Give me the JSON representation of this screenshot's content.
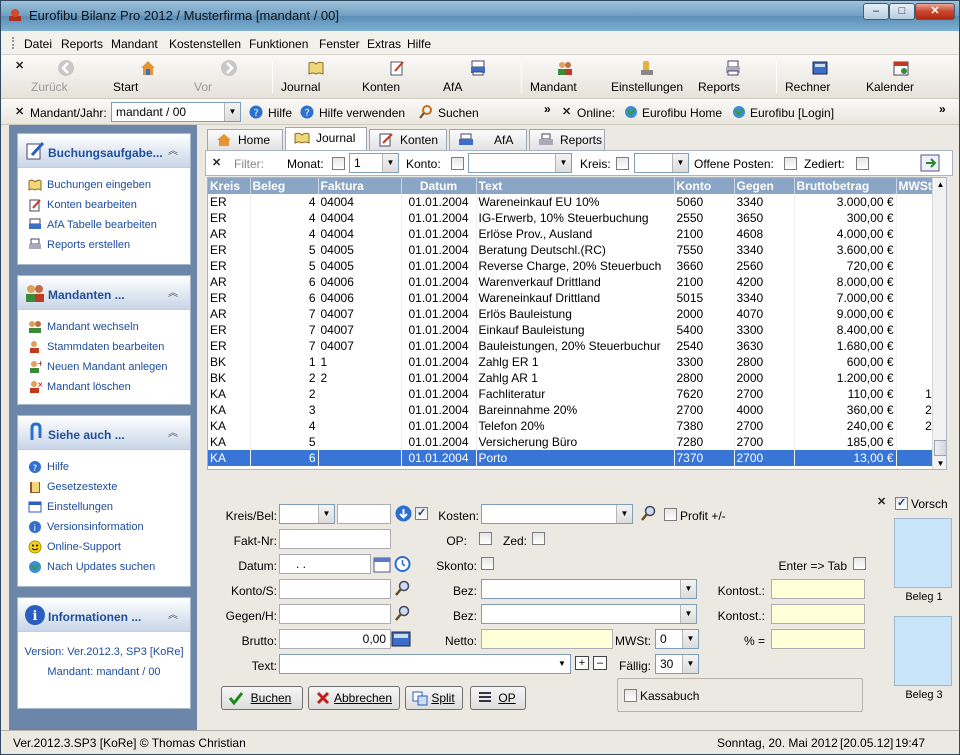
{
  "window": {
    "title": "Eurofibu Bilanz Pro 2012 / Musterfirma [mandant / 00]"
  },
  "menu": [
    "Datei",
    "Reports",
    "Mandant",
    "Kostenstellen",
    "Funktionen",
    "Fenster",
    "Extras",
    "Hilfe"
  ],
  "toolbar": {
    "zurueck": "Zurück",
    "start": "Start",
    "vor": "Vor",
    "journal": "Journal",
    "konten": "Konten",
    "afa": "AfA",
    "mandant": "Mandant",
    "einstellungen": "Einstellungen",
    "reports": "Reports",
    "rechner": "Rechner",
    "kalender": "Kalender"
  },
  "bar2": {
    "mandant_label": "Mandant/Jahr:",
    "mandant_value": "mandant / 00",
    "hilfe": "Hilfe",
    "hilfe_verwenden": "Hilfe verwenden",
    "suchen": "Suchen",
    "online": "Online:",
    "eurofibu_home": "Eurofibu Home",
    "eurofibu_login": "Eurofibu [Login]"
  },
  "sidebar": {
    "buchung": {
      "title": "Buchungsaufgabe...",
      "items": [
        "Buchungen eingeben",
        "Konten bearbeiten",
        "AfA Tabelle bearbeiten",
        "Reports erstellen"
      ]
    },
    "mandanten": {
      "title": "Mandanten ...",
      "items": [
        "Mandant wechseln",
        "Stammdaten bearbeiten",
        "Neuen Mandant anlegen",
        "Mandant löschen"
      ]
    },
    "siehe": {
      "title": "Siehe auch ...",
      "items": [
        "Hilfe",
        "Gesetzestexte",
        "Einstellungen",
        "Versionsinformation",
        "Online-Support",
        "Nach Updates suchen"
      ]
    },
    "info": {
      "title": "Informationen ...",
      "version": "Version: Ver.2012.3, SP3 [KoRe]",
      "mandant": "Mandant: mandant / 00"
    }
  },
  "tabs": [
    "Home",
    "Journal",
    "Konten",
    "AfA",
    "Reports"
  ],
  "filter": {
    "filter": "Filter:",
    "monat": "Monat:",
    "monat_value": "1",
    "konto": "Konto:",
    "kreis": "Kreis:",
    "offene_posten": "Offene Posten:",
    "zediert": "Zediert:"
  },
  "grid": {
    "columns": [
      "Kreis",
      "Beleg",
      "Faktura",
      "Datum",
      "Text",
      "Konto",
      "Gegen",
      "Bruttobetrag",
      "MWSt"
    ],
    "rows": [
      [
        "ER",
        "4",
        "04004",
        "01.01.2004",
        "Wareneinkauf EU 10%",
        "5060",
        "3340",
        "3.000,00 €",
        ""
      ],
      [
        "ER",
        "4",
        "04004",
        "01.01.2004",
        "IG-Erwerb, 10% Steuerbuchung",
        "2550",
        "3650",
        "300,00 €",
        ""
      ],
      [
        "AR",
        "4",
        "04004",
        "01.01.2004",
        "Erlöse Prov., Ausland",
        "2100",
        "4608",
        "4.000,00 €",
        ""
      ],
      [
        "ER",
        "5",
        "04005",
        "01.01.2004",
        "Beratung Deutschl.(RC)",
        "7550",
        "3340",
        "3.600,00 €",
        ""
      ],
      [
        "ER",
        "5",
        "04005",
        "01.01.2004",
        "Reverse Charge, 20% Steuerbuch",
        "3660",
        "2560",
        "720,00 €",
        ""
      ],
      [
        "AR",
        "6",
        "04006",
        "01.01.2004",
        "Warenverkauf Drittland",
        "2100",
        "4200",
        "8.000,00 €",
        ""
      ],
      [
        "ER",
        "6",
        "04006",
        "01.01.2004",
        "Wareneinkauf Drittland",
        "5015",
        "3340",
        "7.000,00 €",
        ""
      ],
      [
        "AR",
        "7",
        "04007",
        "01.01.2004",
        "Erlös Bauleistung",
        "2000",
        "4070",
        "9.000,00 €",
        ""
      ],
      [
        "ER",
        "7",
        "04007",
        "01.01.2004",
        "Einkauf Bauleistung",
        "5400",
        "3300",
        "8.400,00 €",
        ""
      ],
      [
        "ER",
        "7",
        "04007",
        "01.01.2004",
        "Bauleistungen, 20% Steuerbuchur",
        "2540",
        "3630",
        "1.680,00 €",
        ""
      ],
      [
        "BK",
        "1",
        "1",
        "01.01.2004",
        "Zahlg ER 1",
        "3300",
        "2800",
        "600,00 €",
        ""
      ],
      [
        "BK",
        "2",
        "2",
        "01.01.2004",
        "Zahlg AR 1",
        "2800",
        "2000",
        "1.200,00 €",
        ""
      ],
      [
        "KA",
        "2",
        "",
        "01.01.2004",
        "Fachliteratur",
        "7620",
        "2700",
        "110,00 €",
        "1"
      ],
      [
        "KA",
        "3",
        "",
        "01.01.2004",
        "Bareinnahme 20%",
        "2700",
        "4000",
        "360,00 €",
        "2"
      ],
      [
        "KA",
        "4",
        "",
        "01.01.2004",
        "Telefon 20%",
        "7380",
        "2700",
        "240,00 €",
        "2"
      ],
      [
        "KA",
        "5",
        "",
        "01.01.2004",
        "Versicherung Büro",
        "7280",
        "2700",
        "185,00 €",
        ""
      ],
      [
        "KA",
        "6",
        "",
        "01.01.2004",
        "Porto",
        "7370",
        "2700",
        "13,00 €",
        ""
      ]
    ]
  },
  "form": {
    "kreis_bel": "Kreis/Bel:",
    "kosten": "Kosten:",
    "profit": "Profit +/-",
    "fakt_nr": "Fakt-Nr:",
    "op": "OP:",
    "zed": "Zed:",
    "datum": "Datum:",
    "datum_value": ". .",
    "skonto": "Skonto:",
    "enter_tab": "Enter => Tab",
    "konto_s": "Konto/S:",
    "bez": "Bez:",
    "kontost": "Kontost.:",
    "gegen_h": "Gegen/H:",
    "brutto": "Brutto:",
    "brutto_value": "0,00",
    "netto": "Netto:",
    "mwst": "MWSt:",
    "mwst_value": "0",
    "prozent": "% =",
    "text": "Text:",
    "faellig": "Fällig:",
    "faellig_value": "30",
    "buchen": "Buchen",
    "abbrechen": "Abbrechen",
    "split": "Split",
    "op_btn": "OP",
    "kassabuch": "Kassabuch"
  },
  "preview": {
    "vorschau": "Vorsch",
    "beleg1": "Beleg 1",
    "beleg3": "Beleg 3"
  },
  "status": {
    "version": "Ver.2012.3.SP3 [KoRe] © Thomas Christian",
    "date": "Sonntag, 20. Mai 2012",
    "date_short": "[20.05.12]",
    "time": "19:47"
  },
  "colors": {
    "grid_header": "#8aa5c6",
    "selection": "#3875d7",
    "sidebar": "#6b86a8",
    "link": "#1d4c9c"
  }
}
